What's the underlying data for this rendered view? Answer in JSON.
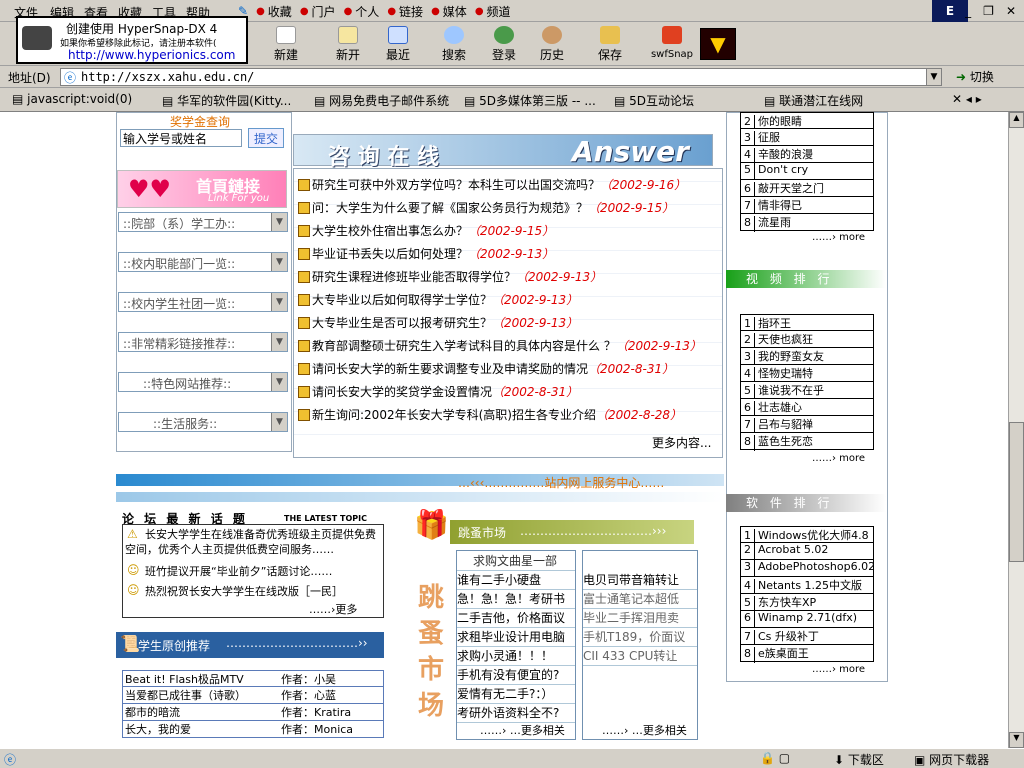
{
  "menu": {
    "file": "文件",
    "edit": "编辑",
    "view": "查看",
    "favorites": "收藏",
    "tools": "工具",
    "help": "帮助"
  },
  "links": [
    "收藏",
    "门户",
    "个人",
    "链接",
    "媒体",
    "频道"
  ],
  "toolbar": {
    "new": "新建",
    "open": "新开",
    "recent": "最近",
    "search": "搜索",
    "login": "登录",
    "history": "历史",
    "save": "保存",
    "swf": "swfSnap"
  },
  "hypersnap": {
    "title": "创建使用 HyperSnap-DX 4",
    "note": "如果你希望移除此标记，请注册本软件(",
    "url": "http://www.hyperionics.com"
  },
  "address": {
    "label": "地址(D)",
    "url": "http://xszx.xahu.edu.cn/",
    "go": "切换"
  },
  "favorites": [
    "javascript:void(0)",
    "华军的软件园(Kitty...",
    "网易免费电子邮件系统",
    "5D多媒体第三版 -- ...",
    "5D互动论坛",
    "联通潜江在线网"
  ],
  "left": {
    "scholarship": "奖学金查询",
    "search_placeholder": "输入学号或姓名",
    "submit": "提交",
    "banner_title": "首頁鏈接",
    "banner_sub": "Link For you",
    "selects": [
      "::院部（系）学工办::",
      "::校内职能部门一览::",
      "::校内学生社团一览::",
      "::非常精彩链接推荐::",
      "::特色网站推荐::",
      "::生活服务::"
    ]
  },
  "answer": {
    "zh": "咨 询 在 线",
    "en": "Answer",
    "more": "更多内容...",
    "items": [
      {
        "q": "研究生可获中外双方学位吗？本科生可以出国交流吗？",
        "d": "（2002-9-16）"
      },
      {
        "q": "问：大学生为什么要了解《国家公务员行为规范》？",
        "d": "（2002-9-15）"
      },
      {
        "q": "大学生校外住宿出事怎么办？",
        "d": "（2002-9-15）"
      },
      {
        "q": "毕业证书丢失以后如何处理？",
        "d": "（2002-9-13）"
      },
      {
        "q": "研究生课程进修班毕业能否取得学位？",
        "d": "（2002-9-13）"
      },
      {
        "q": "大专毕业以后如何取得学士学位？",
        "d": "（2002-9-13）"
      },
      {
        "q": "大专毕业生是否可以报考研究生？",
        "d": "（2002-9-13）"
      },
      {
        "q": "教育部调整硕士研究生入学考试科目的具体内容是什么 ？",
        "d": "（2002-9-13）"
      },
      {
        "q": "请问长安大学的新生要求调整专业及申请奖励的情况",
        "d": "（2002-8-31）"
      },
      {
        "q": "请问长安大学的奖贷学金设置情况",
        "d": "（2002-8-31）"
      },
      {
        "q": "新生询问:2002年长安大学专科(高职)招生各专业介绍",
        "d": "（2002-8-28）"
      }
    ]
  },
  "music": {
    "items": [
      {
        "n": "2",
        "v": "你的眼睛"
      },
      {
        "n": "3",
        "v": "征服"
      },
      {
        "n": "4",
        "v": "辛酸的浪漫"
      },
      {
        "n": "5",
        "v": "Don't cry"
      },
      {
        "n": "6",
        "v": "敲开天堂之门"
      },
      {
        "n": "7",
        "v": "情非得已"
      },
      {
        "n": "8",
        "v": "流星雨"
      }
    ],
    "more": "……› more"
  },
  "video": {
    "title": "视 频 排 行",
    "items": [
      {
        "n": "1",
        "v": "指环王"
      },
      {
        "n": "2",
        "v": "天使也疯狂"
      },
      {
        "n": "3",
        "v": "我的野蛮女友"
      },
      {
        "n": "4",
        "v": "怪物史瑞特"
      },
      {
        "n": "5",
        "v": "谁说我不在乎"
      },
      {
        "n": "6",
        "v": "壮志雄心"
      },
      {
        "n": "7",
        "v": "吕布与貂禅"
      },
      {
        "n": "8",
        "v": "蓝色生死恋"
      }
    ],
    "more": "……› more"
  },
  "software": {
    "title": "软 件 排 行",
    "items": [
      {
        "n": "1",
        "v": "Windows优化大师4.8"
      },
      {
        "n": "2",
        "v": "Acrobat 5.02"
      },
      {
        "n": "3",
        "v": "AdobePhotoshop6.02"
      },
      {
        "n": "4",
        "v": "Netants 1.25中文版"
      },
      {
        "n": "5",
        "v": "东方快车XP"
      },
      {
        "n": "6",
        "v": "Winamp 2.71(dfx)"
      },
      {
        "n": "7",
        "v": "Cs 升级补丁"
      },
      {
        "n": "8",
        "v": "e族桌面王"
      }
    ],
    "more": "……› more"
  },
  "service": "…‹‹‹……………站内网上服务中心……",
  "forum": {
    "title": "论 坛 最 新 话 题",
    "sub": "THE LATEST TOPIC",
    "items": [
      "长安大学学生在线准备奇优秀班级主页提供免费空间，优秀个人主页提供低费空间服务……",
      "班竹提议开展“毕业前夕”话题讨论……",
      "热烈祝贺长安大学学生在线改版［一民］"
    ],
    "more": "……›更多"
  },
  "original": {
    "title": "学生原创推荐",
    "items": [
      {
        "t": "Beat it! Flash极品MTV",
        "a": "作者：小吴"
      },
      {
        "t": "当爱都已成往事（诗歌）",
        "a": "作者：心蓝"
      },
      {
        "t": "都市的暗流",
        "a": "作者：Kratira"
      },
      {
        "t": "长大，我的爱",
        "a": "作者：Monica"
      }
    ]
  },
  "market": {
    "title": "跳蚤市场",
    "vertical": "跳蚤市场",
    "col1": [
      "求购文曲星一部",
      "谁有二手小硬盘",
      "急！急！急！考研书",
      "二手吉他，价格面议",
      "求租毕业设计用电脑",
      "求购小灵通！！！",
      "手机有没有便宜的?",
      "爱情有无二手?：）",
      "考研外语资料全不?"
    ],
    "col2": [
      "电贝司带音箱转让",
      "富士通笔记本超低",
      "毕业二手挥泪甩卖",
      "手机T189，价面议",
      "CII 433 CPU转让"
    ],
    "more": "……› …更多相关"
  },
  "status": {
    "download": "下载区",
    "downloader": "网页下载器"
  }
}
